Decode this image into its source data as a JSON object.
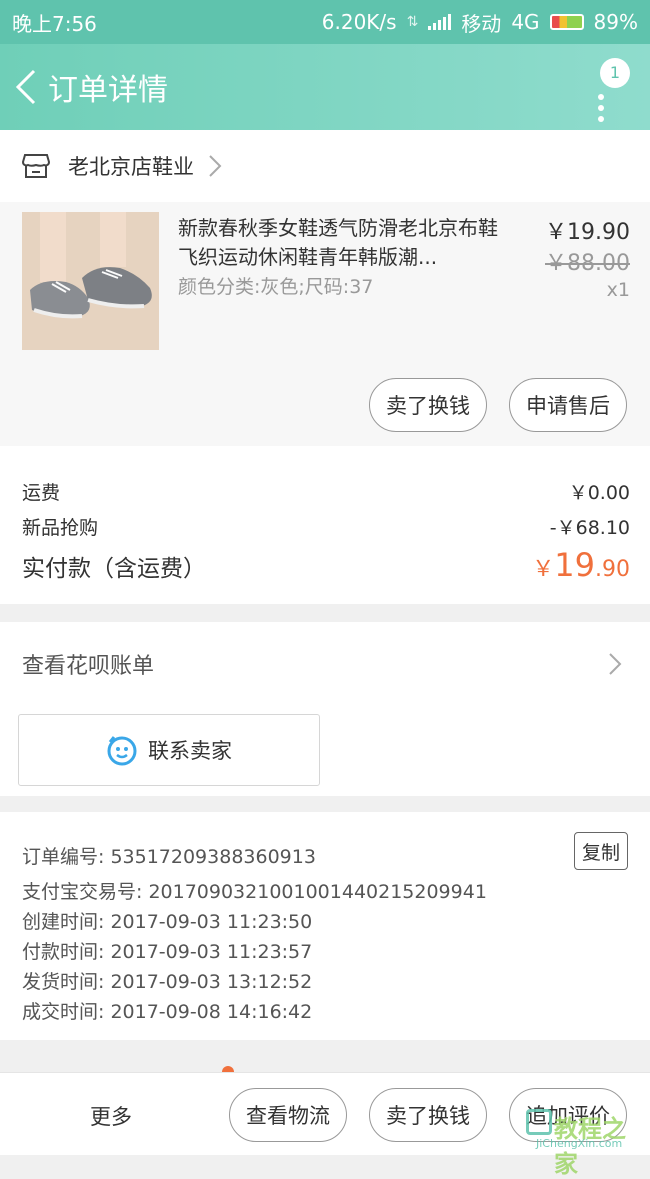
{
  "status": {
    "time": "晚上7:56",
    "speed": "6.20K/s",
    "carrier": "移动",
    "network": "4G",
    "battery": "89%"
  },
  "nav": {
    "title": "订单详情",
    "badge": "1"
  },
  "shop": {
    "name": "老北京店鞋业"
  },
  "product": {
    "title": "新款春秋季女鞋透气防滑老北京布鞋飞织运动休闲鞋青年韩版潮...",
    "spec": "颜色分类:灰色;尺码:37",
    "price": "￥19.90",
    "original_price": "￥88.00",
    "quantity": "x1",
    "buttons": {
      "sell": "卖了换钱",
      "after_sale": "申请售后"
    }
  },
  "fees": {
    "shipping_label": "运费",
    "shipping_value": "￥0.00",
    "discount_label": "新品抢购",
    "discount_value": "-￥68.10",
    "total_label": "实付款（含运费）",
    "total_currency": "￥",
    "total_int": "19",
    "total_dec": ".90"
  },
  "huabei": {
    "label": "查看花呗账单",
    "contact_label": "联系卖家"
  },
  "order_info": {
    "order_no": "订单编号: 53517209388360913",
    "alipay_no": "支付宝交易号: 2017090321001001440215209941",
    "created": "创建时间: 2017-09-03 11:23:50",
    "paid": "付款时间: 2017-09-03 11:23:57",
    "shipped": "发货时间: 2017-09-03 13:12:52",
    "completed": "成交时间: 2017-09-08 14:16:42",
    "copy_label": "复制"
  },
  "bottom": {
    "more": "更多",
    "logistics": "查看物流",
    "sell": "卖了换钱",
    "review": "追加评价"
  },
  "watermark": {
    "brand": "教程之家",
    "url": "JiChengXin.com"
  },
  "colors": {
    "accent": "#5fc3ad",
    "price_orange": "#f0703c"
  }
}
